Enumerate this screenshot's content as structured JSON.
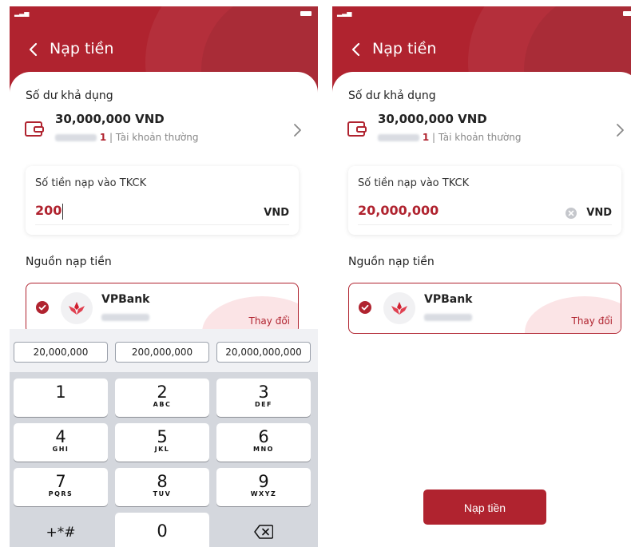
{
  "colors": {
    "brand": "#b0232f",
    "surface": "#ffffff",
    "keyboard": "#d4d7dd"
  },
  "screens": [
    {
      "title": "Nạp tiền",
      "balance_label": "Số dư khả dụng",
      "balance": "30,000,000 VND",
      "account_suffix": "1",
      "account_type": "Tài khoản thường",
      "amount_label": "Số tiền nạp vào TKCK",
      "amount_value": "200",
      "currency": "VND",
      "source_label": "Nguồn nạp tiền",
      "bank_name": "VPBank",
      "change_label": "Thay đổi",
      "keyboard": {
        "suggestions": [
          "20,000,000",
          "200,000,000",
          "20,000,000,000"
        ],
        "keys": [
          {
            "num": "1",
            "letters": ""
          },
          {
            "num": "2",
            "letters": "ABC"
          },
          {
            "num": "3",
            "letters": "DEF"
          },
          {
            "num": "4",
            "letters": "GHI"
          },
          {
            "num": "5",
            "letters": "JKL"
          },
          {
            "num": "6",
            "letters": "MNO"
          },
          {
            "num": "7",
            "letters": "PQRS"
          },
          {
            "num": "8",
            "letters": "TUV"
          },
          {
            "num": "9",
            "letters": "WXYZ"
          },
          {
            "num": "+*#",
            "letters": ""
          },
          {
            "num": "0",
            "letters": ""
          }
        ]
      }
    },
    {
      "title": "Nạp tiền",
      "balance_label": "Số dư khả dụng",
      "balance": "30,000,000 VND",
      "account_suffix": "1",
      "account_type": "Tài khoản thường",
      "amount_label": "Số tiền nạp vào TKCK",
      "amount_value": "20,000,000",
      "currency": "VND",
      "source_label": "Nguồn nạp tiền",
      "bank_name": "VPBank",
      "change_label": "Thay đổi",
      "submit_label": "Nạp tiền"
    }
  ]
}
